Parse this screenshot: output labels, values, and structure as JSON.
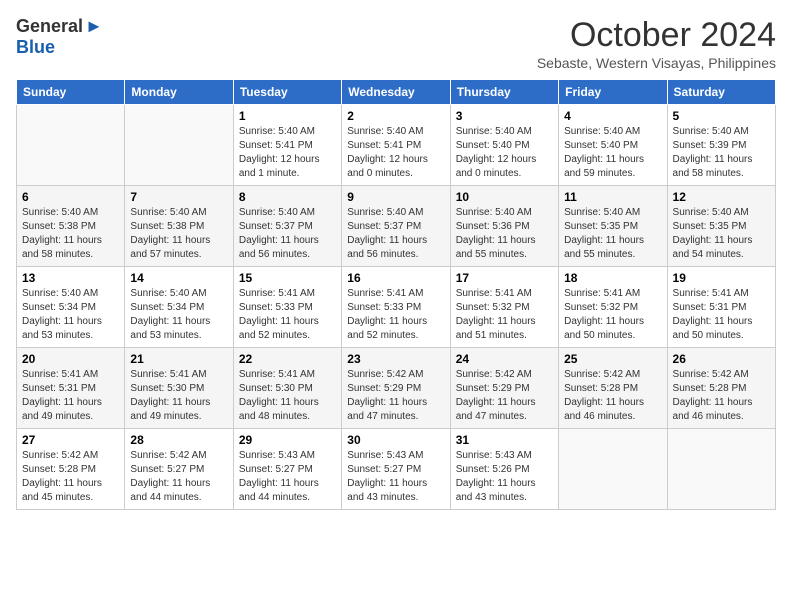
{
  "logo": {
    "general": "General",
    "blue": "Blue"
  },
  "title": "October 2024",
  "location": "Sebaste, Western Visayas, Philippines",
  "days_of_week": [
    "Sunday",
    "Monday",
    "Tuesday",
    "Wednesday",
    "Thursday",
    "Friday",
    "Saturday"
  ],
  "weeks": [
    [
      {
        "day": "",
        "info": ""
      },
      {
        "day": "",
        "info": ""
      },
      {
        "day": "1",
        "info": "Sunrise: 5:40 AM\nSunset: 5:41 PM\nDaylight: 12 hours\nand 1 minute."
      },
      {
        "day": "2",
        "info": "Sunrise: 5:40 AM\nSunset: 5:41 PM\nDaylight: 12 hours\nand 0 minutes."
      },
      {
        "day": "3",
        "info": "Sunrise: 5:40 AM\nSunset: 5:40 PM\nDaylight: 12 hours\nand 0 minutes."
      },
      {
        "day": "4",
        "info": "Sunrise: 5:40 AM\nSunset: 5:40 PM\nDaylight: 11 hours\nand 59 minutes."
      },
      {
        "day": "5",
        "info": "Sunrise: 5:40 AM\nSunset: 5:39 PM\nDaylight: 11 hours\nand 58 minutes."
      }
    ],
    [
      {
        "day": "6",
        "info": "Sunrise: 5:40 AM\nSunset: 5:38 PM\nDaylight: 11 hours\nand 58 minutes."
      },
      {
        "day": "7",
        "info": "Sunrise: 5:40 AM\nSunset: 5:38 PM\nDaylight: 11 hours\nand 57 minutes."
      },
      {
        "day": "8",
        "info": "Sunrise: 5:40 AM\nSunset: 5:37 PM\nDaylight: 11 hours\nand 56 minutes."
      },
      {
        "day": "9",
        "info": "Sunrise: 5:40 AM\nSunset: 5:37 PM\nDaylight: 11 hours\nand 56 minutes."
      },
      {
        "day": "10",
        "info": "Sunrise: 5:40 AM\nSunset: 5:36 PM\nDaylight: 11 hours\nand 55 minutes."
      },
      {
        "day": "11",
        "info": "Sunrise: 5:40 AM\nSunset: 5:35 PM\nDaylight: 11 hours\nand 55 minutes."
      },
      {
        "day": "12",
        "info": "Sunrise: 5:40 AM\nSunset: 5:35 PM\nDaylight: 11 hours\nand 54 minutes."
      }
    ],
    [
      {
        "day": "13",
        "info": "Sunrise: 5:40 AM\nSunset: 5:34 PM\nDaylight: 11 hours\nand 53 minutes."
      },
      {
        "day": "14",
        "info": "Sunrise: 5:40 AM\nSunset: 5:34 PM\nDaylight: 11 hours\nand 53 minutes."
      },
      {
        "day": "15",
        "info": "Sunrise: 5:41 AM\nSunset: 5:33 PM\nDaylight: 11 hours\nand 52 minutes."
      },
      {
        "day": "16",
        "info": "Sunrise: 5:41 AM\nSunset: 5:33 PM\nDaylight: 11 hours\nand 52 minutes."
      },
      {
        "day": "17",
        "info": "Sunrise: 5:41 AM\nSunset: 5:32 PM\nDaylight: 11 hours\nand 51 minutes."
      },
      {
        "day": "18",
        "info": "Sunrise: 5:41 AM\nSunset: 5:32 PM\nDaylight: 11 hours\nand 50 minutes."
      },
      {
        "day": "19",
        "info": "Sunrise: 5:41 AM\nSunset: 5:31 PM\nDaylight: 11 hours\nand 50 minutes."
      }
    ],
    [
      {
        "day": "20",
        "info": "Sunrise: 5:41 AM\nSunset: 5:31 PM\nDaylight: 11 hours\nand 49 minutes."
      },
      {
        "day": "21",
        "info": "Sunrise: 5:41 AM\nSunset: 5:30 PM\nDaylight: 11 hours\nand 49 minutes."
      },
      {
        "day": "22",
        "info": "Sunrise: 5:41 AM\nSunset: 5:30 PM\nDaylight: 11 hours\nand 48 minutes."
      },
      {
        "day": "23",
        "info": "Sunrise: 5:42 AM\nSunset: 5:29 PM\nDaylight: 11 hours\nand 47 minutes."
      },
      {
        "day": "24",
        "info": "Sunrise: 5:42 AM\nSunset: 5:29 PM\nDaylight: 11 hours\nand 47 minutes."
      },
      {
        "day": "25",
        "info": "Sunrise: 5:42 AM\nSunset: 5:28 PM\nDaylight: 11 hours\nand 46 minutes."
      },
      {
        "day": "26",
        "info": "Sunrise: 5:42 AM\nSunset: 5:28 PM\nDaylight: 11 hours\nand 46 minutes."
      }
    ],
    [
      {
        "day": "27",
        "info": "Sunrise: 5:42 AM\nSunset: 5:28 PM\nDaylight: 11 hours\nand 45 minutes."
      },
      {
        "day": "28",
        "info": "Sunrise: 5:42 AM\nSunset: 5:27 PM\nDaylight: 11 hours\nand 44 minutes."
      },
      {
        "day": "29",
        "info": "Sunrise: 5:43 AM\nSunset: 5:27 PM\nDaylight: 11 hours\nand 44 minutes."
      },
      {
        "day": "30",
        "info": "Sunrise: 5:43 AM\nSunset: 5:27 PM\nDaylight: 11 hours\nand 43 minutes."
      },
      {
        "day": "31",
        "info": "Sunrise: 5:43 AM\nSunset: 5:26 PM\nDaylight: 11 hours\nand 43 minutes."
      },
      {
        "day": "",
        "info": ""
      },
      {
        "day": "",
        "info": ""
      }
    ]
  ]
}
